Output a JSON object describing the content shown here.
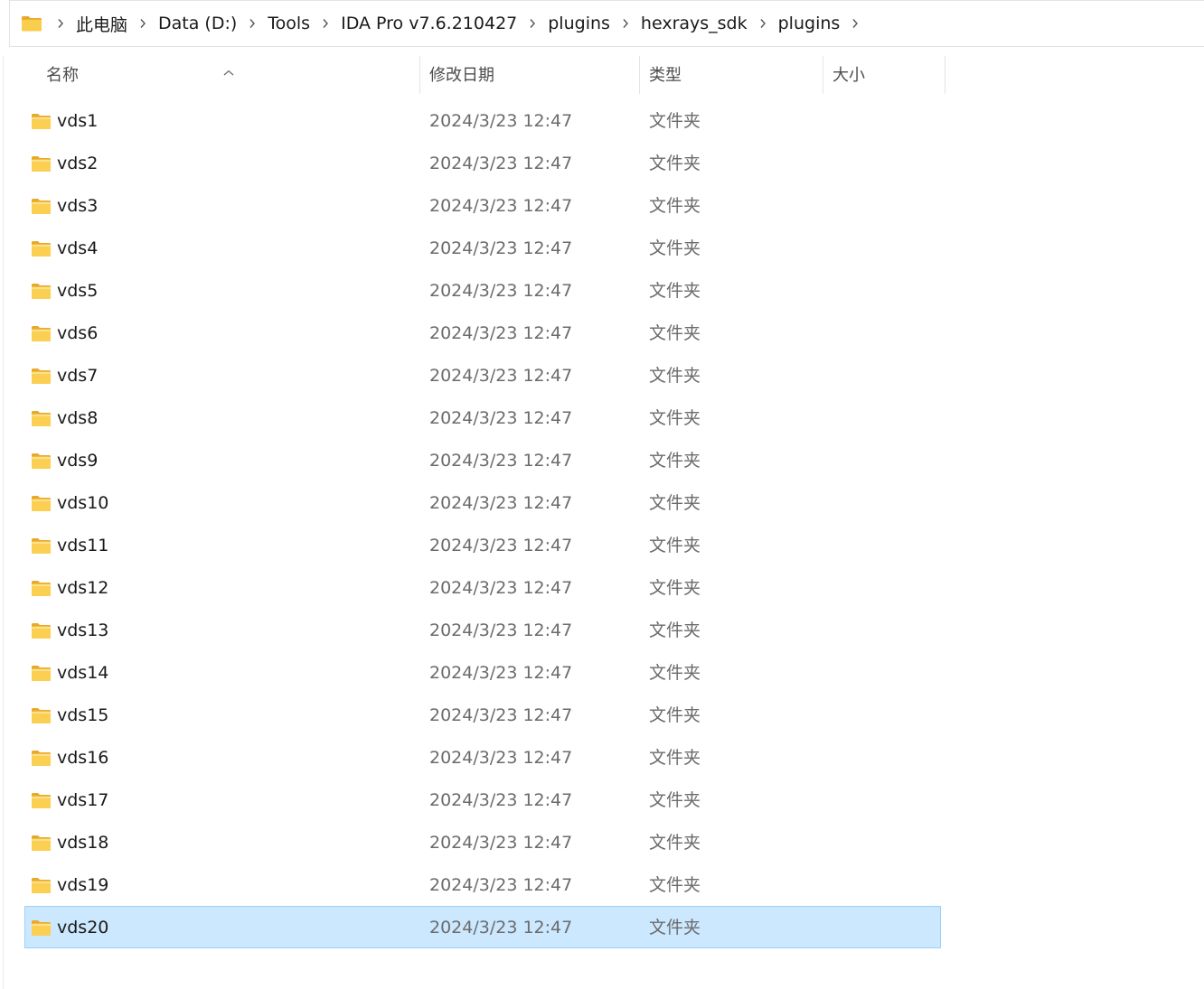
{
  "breadcrumb": {
    "icon": "folder-icon",
    "items": [
      "此电脑",
      "Data (D:)",
      "Tools",
      "IDA Pro v7.6.210427",
      "plugins",
      "hexrays_sdk",
      "plugins"
    ]
  },
  "columns": {
    "name": "名称",
    "date": "修改日期",
    "type": "类型",
    "size": "大小",
    "sort_icon": "sort-ascending-icon"
  },
  "colors": {
    "folder": "#f7c542",
    "selection_bg": "#cce8ff",
    "selection_border": "#99d1ff"
  },
  "files": [
    {
      "name": "vds1",
      "date": "2024/3/23 12:47",
      "type": "文件夹",
      "size": "",
      "icon": "folder-icon"
    },
    {
      "name": "vds2",
      "date": "2024/3/23 12:47",
      "type": "文件夹",
      "size": "",
      "icon": "folder-icon"
    },
    {
      "name": "vds3",
      "date": "2024/3/23 12:47",
      "type": "文件夹",
      "size": "",
      "icon": "folder-icon"
    },
    {
      "name": "vds4",
      "date": "2024/3/23 12:47",
      "type": "文件夹",
      "size": "",
      "icon": "folder-icon"
    },
    {
      "name": "vds5",
      "date": "2024/3/23 12:47",
      "type": "文件夹",
      "size": "",
      "icon": "folder-icon"
    },
    {
      "name": "vds6",
      "date": "2024/3/23 12:47",
      "type": "文件夹",
      "size": "",
      "icon": "folder-icon"
    },
    {
      "name": "vds7",
      "date": "2024/3/23 12:47",
      "type": "文件夹",
      "size": "",
      "icon": "folder-icon"
    },
    {
      "name": "vds8",
      "date": "2024/3/23 12:47",
      "type": "文件夹",
      "size": "",
      "icon": "folder-icon"
    },
    {
      "name": "vds9",
      "date": "2024/3/23 12:47",
      "type": "文件夹",
      "size": "",
      "icon": "folder-icon"
    },
    {
      "name": "vds10",
      "date": "2024/3/23 12:47",
      "type": "文件夹",
      "size": "",
      "icon": "folder-icon"
    },
    {
      "name": "vds11",
      "date": "2024/3/23 12:47",
      "type": "文件夹",
      "size": "",
      "icon": "folder-icon"
    },
    {
      "name": "vds12",
      "date": "2024/3/23 12:47",
      "type": "文件夹",
      "size": "",
      "icon": "folder-icon"
    },
    {
      "name": "vds13",
      "date": "2024/3/23 12:47",
      "type": "文件夹",
      "size": "",
      "icon": "folder-icon"
    },
    {
      "name": "vds14",
      "date": "2024/3/23 12:47",
      "type": "文件夹",
      "size": "",
      "icon": "folder-icon"
    },
    {
      "name": "vds15",
      "date": "2024/3/23 12:47",
      "type": "文件夹",
      "size": "",
      "icon": "folder-icon"
    },
    {
      "name": "vds16",
      "date": "2024/3/23 12:47",
      "type": "文件夹",
      "size": "",
      "icon": "folder-icon"
    },
    {
      "name": "vds17",
      "date": "2024/3/23 12:47",
      "type": "文件夹",
      "size": "",
      "icon": "folder-icon"
    },
    {
      "name": "vds18",
      "date": "2024/3/23 12:47",
      "type": "文件夹",
      "size": "",
      "icon": "folder-icon"
    },
    {
      "name": "vds19",
      "date": "2024/3/23 12:47",
      "type": "文件夹",
      "size": "",
      "icon": "folder-icon"
    },
    {
      "name": "vds20",
      "date": "2024/3/23 12:47",
      "type": "文件夹",
      "size": "",
      "icon": "folder-icon",
      "selected": true
    }
  ]
}
